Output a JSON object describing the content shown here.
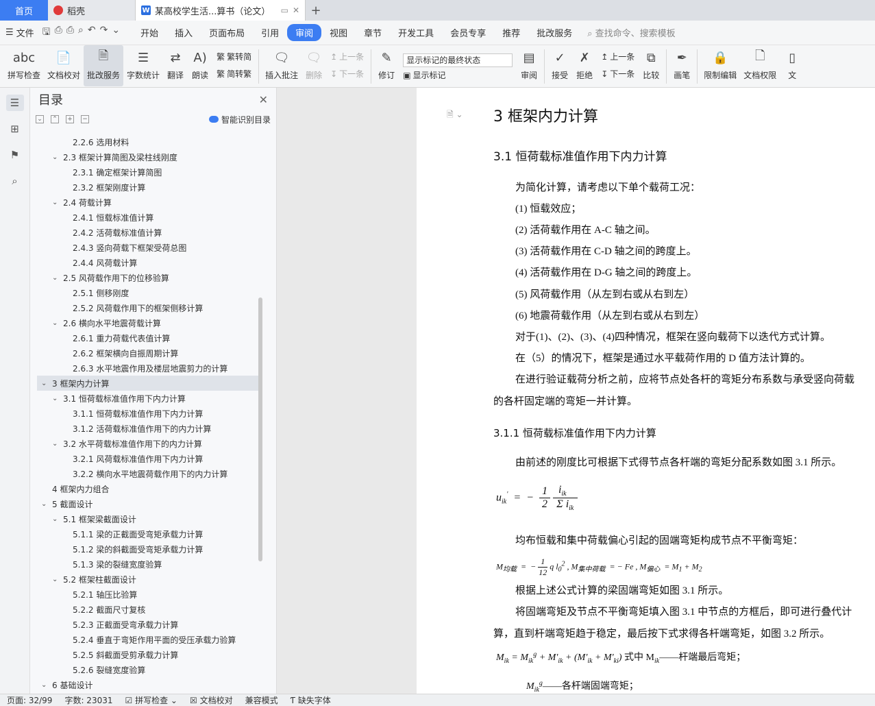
{
  "tabs": {
    "home": "首页",
    "dk": "稻壳",
    "doc": "某高校学生活...算书（论文）",
    "plus": "+"
  },
  "menubar": {
    "file": "文件",
    "items": [
      "开始",
      "插入",
      "页面布局",
      "引用",
      "审阅",
      "视图",
      "章节",
      "开发工具",
      "会员专享",
      "推荐",
      "批改服务"
    ],
    "active_index": 4,
    "search": "查找命令、搜索模板"
  },
  "ribbon": {
    "spell": "拼写检查",
    "proof": "文档校对",
    "correct": "批改服务",
    "wordcount": "字数统计",
    "translate": "翻译",
    "read": "朗读",
    "t2s": "繁转简",
    "s2t": "简转繁",
    "insert_comment": "插入批注",
    "delete": "删除",
    "prev": "上一条",
    "next": "下一条",
    "track": "修订",
    "markup_select": "显示标记的最终状态",
    "show_markup": "显示标记",
    "review": "审阅",
    "accept": "接受",
    "reject": "拒绝",
    "prev2": "上一条",
    "next2": "下一条",
    "compare": "比较",
    "pen": "画笔",
    "restrict": "限制编辑",
    "rights": "文档权限",
    "more": "文"
  },
  "toc": {
    "title": "目录",
    "smart": "智能识别目录",
    "items": [
      {
        "level": 3,
        "text": "2.2.6  选用材料"
      },
      {
        "level": 2,
        "text": "2.3  框架计算简图及梁柱线刚度"
      },
      {
        "level": 3,
        "text": "2.3.1  确定框架计算简图"
      },
      {
        "level": 3,
        "text": "2.3.2  框架刚度计算"
      },
      {
        "level": 2,
        "text": "2.4  荷载计算"
      },
      {
        "level": 3,
        "text": "2.4.1  恒载标准值计算"
      },
      {
        "level": 3,
        "text": "2.4.2  活荷载标准值计算"
      },
      {
        "level": 3,
        "text": "2.4.3  竖向荷载下框架受荷总图"
      },
      {
        "level": 3,
        "text": "2.4.4  风荷载计算"
      },
      {
        "level": 2,
        "text": "2.5  风荷载作用下的位移验算"
      },
      {
        "level": 3,
        "text": "2.5.1  侧移刚度"
      },
      {
        "level": 3,
        "text": "2.5.2  风荷载作用下的框架侧移计算"
      },
      {
        "level": 2,
        "text": "2.6  横向水平地震荷载计算"
      },
      {
        "level": 3,
        "text": "2.6.1  重力荷载代表值计算"
      },
      {
        "level": 3,
        "text": "2.6.2  框架横向自振周期计算"
      },
      {
        "level": 3,
        "text": "2.6.3 水平地震作用及楼层地震剪力的计算"
      },
      {
        "level": 1,
        "text": "3  框架内力计算",
        "active": true
      },
      {
        "level": 2,
        "text": "3.1  恒荷载标准值作用下内力计算"
      },
      {
        "level": 3,
        "text": "3.1.1  恒荷载标准值作用下内力计算"
      },
      {
        "level": 3,
        "text": "3.1.2  活荷载标准值作用下的内力计算"
      },
      {
        "level": 2,
        "text": "3.2  水平荷载标准值作用下的内力计算"
      },
      {
        "level": 3,
        "text": "3.2.1  风荷载标准值作用下内力计算"
      },
      {
        "level": 3,
        "text": "3.2.2  横向水平地震荷载作用下的内力计算"
      },
      {
        "level": 1,
        "text": "4  框架内力组合",
        "leaf": true
      },
      {
        "level": 1,
        "text": "5  截面设计"
      },
      {
        "level": 2,
        "text": "5.1  框架梁截面设计"
      },
      {
        "level": 3,
        "text": "5.1.1  梁的正截面受弯矩承载力计算"
      },
      {
        "level": 3,
        "text": "5.1.2  梁的斜截面受弯矩承载力计算"
      },
      {
        "level": 3,
        "text": "5.1.3  梁的裂缝宽度验算"
      },
      {
        "level": 2,
        "text": "5.2  框架柱截面设计"
      },
      {
        "level": 3,
        "text": "5.2.1  轴压比验算"
      },
      {
        "level": 3,
        "text": "5.2.2  截面尺寸复核"
      },
      {
        "level": 3,
        "text": "5.2.3  正截面受弯承载力计算"
      },
      {
        "level": 3,
        "text": "5.2.4  垂直于弯矩作用平面的受压承载力验算"
      },
      {
        "level": 3,
        "text": "5.2.5  斜截面受剪承载力计算"
      },
      {
        "level": 3,
        "text": "5.2.6  裂缝宽度验算"
      },
      {
        "level": 1,
        "text": "6  基础设计"
      }
    ]
  },
  "doc": {
    "h1": "3  框架内力计算",
    "h2": "3.1  恒荷载标准值作用下内力计算",
    "p_intro": "为简化计算，请考虑以下单个载荷工况：",
    "cases": [
      "(1)  恒载效应；",
      "(2)  活荷载作用在 A-C 轴之间。",
      "(3)  活荷载作用在 C-D  轴之间的跨度上。",
      "(4)  活荷载作用在 D-G  轴之间的跨度上。",
      "(5)  风荷载作用（从左到右或从右到左）",
      "(6)  地震荷载作用（从左到右或从右到左）"
    ],
    "p_iter": "对于(1)、(2)、(3)、(4)四种情况，框架在竖向载荷下以迭代方式计算。",
    "p_d": "在（5）的情况下，框架是通过水平载荷作用的 D 值方法计算的。",
    "p_before_1": "在进行验证载荷分析之前，应将节点处各杆的弯矩分布系数与承受竖向荷载",
    "p_before_2": "的各杆固定端的弯矩一并计算。",
    "h3": "3.1.1  恒荷载标准值作用下内力计算",
    "p_stiff": "由前述的刚度比可根据下式得节点各杆端的弯矩分配系数如图 3.1  所示。",
    "p_unbal": "均布恒载和集中荷载偏心引起的固端弯矩构成节点不平衡弯矩：",
    "p_fig": "根据上述公式计算的梁固端弯矩如图 3.1  所示。",
    "p_fill_1": "将固端弯矩及节点不平衡弯矩填入图 3.1 中节点的方框后，即可进行叠代计",
    "p_fill_2": "算，直到杆端弯矩趋于稳定，最后按下式求得各杆端弯矩，如图 3.2  所示。",
    "p_formula_tail": "式中    M",
    "p_final_desc": "——杆端最后弯矩；",
    "p_fixed_desc": "——各杆端固端弯矩；"
  },
  "status": {
    "page": "页面: 32/99",
    "words": "字数: 23031",
    "spell": "拼写检查",
    "proof": "文档校对",
    "compat": "兼容模式",
    "missing": "缺失字体"
  }
}
